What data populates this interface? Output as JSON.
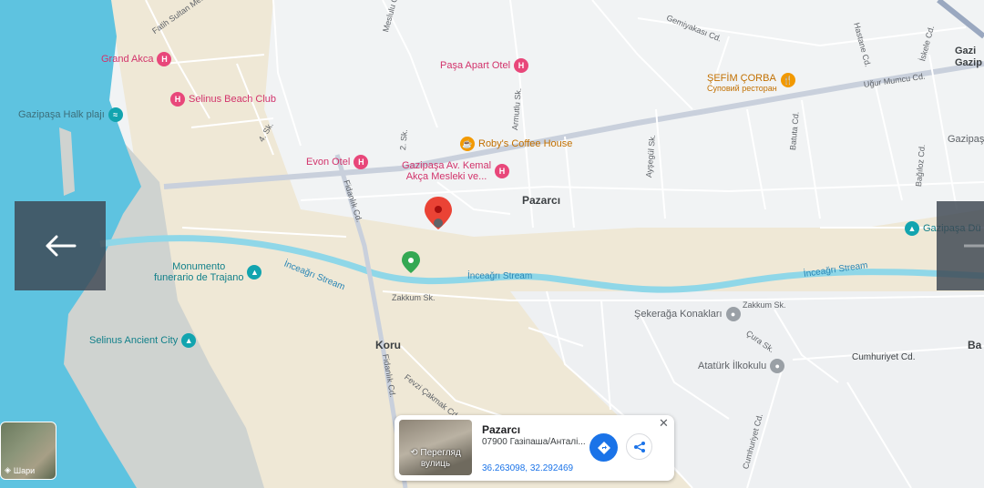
{
  "places": {
    "grand_akca": "Grand Akca",
    "selinus_beach_club": "Selinus Beach Club",
    "halk_plaji": "Gazipaşa Halk plajı",
    "pasa_apart": "Paşa Apart Otel",
    "sefim_corba": "ŞEFİM ÇORBA",
    "sefim_sub": "Суповий ресторан",
    "robys": "Roby's Coffee House",
    "evon": "Evon Otel",
    "kemal_line1": "Gazipaşa Av. Kemal",
    "kemal_line2": "Akça Mesleki ve...",
    "monumento_line1": "Monumento",
    "monumento_line2": "funerario de Trajano",
    "selinus_ancient": "Selinus Ancient City",
    "sekeraga": "Şekerağa Konakları",
    "ataturk": "Atatürk İlkokulu",
    "gazipasa_du": "Gazipaşa Dü",
    "gazipasa_right": "Gazipaşa",
    "gazi_top": "Gazi",
    "gazip_top": "Gazip"
  },
  "areas": {
    "pazarci": "Pazarcı",
    "koru": "Koru",
    "ba": "Ba"
  },
  "streets": {
    "fatih_sultan": "Fatih Sultan Meh",
    "meslulu": "Meslulu Cd.",
    "gemiyakası": "Gemiyakası Cd.",
    "hastane": "Hastane Cd.",
    "iskele": "İskele Cd.",
    "ugur_mumcu": "Uğur Mumcu Cd.",
    "armutlu": "Armutlu Sk.",
    "four_sk": "4. Sk.",
    "two_sk": "2. Sk.",
    "fidanlik_1": "Fidanlık Cd.",
    "fidanlik_2": "Fidanlık Cd.",
    "aysegul": "Ayşegül Sk.",
    "batuta": "Batuta Cd.",
    "bagiloz": "Bağıloz Cd.",
    "zakkum_1": "Zakkum Sk.",
    "zakkum_2": "Zakkum Sk.",
    "fevzi": "Fevzi Çakmak Cd.",
    "cura": "Çura Sk.",
    "cumhuriyet_1": "Cumhuriyet Cd.",
    "cumhuriyet_2": "Cumhuriyet Cd."
  },
  "streams": {
    "s1": "İnceağrı Stream",
    "s2": "İnceağrı Stream",
    "s3": "İnceağrı Stream"
  },
  "thumb_label": "Шари",
  "card": {
    "title": "Pazarcı",
    "address": "07900 Газіпаша/Анталі...",
    "coords": "36.263098, 32.292469",
    "photo_label_1": "Перегляд",
    "photo_label_2": "вулиць",
    "close": "✕"
  },
  "colors": {
    "sea": "#5ec3e0",
    "land": "#f1f3f4",
    "beach": "#efe8d6",
    "stream": "#8fd7e8",
    "road": "#ffffff",
    "major_road": "#c9d0dc",
    "marker": "#ea4335"
  }
}
